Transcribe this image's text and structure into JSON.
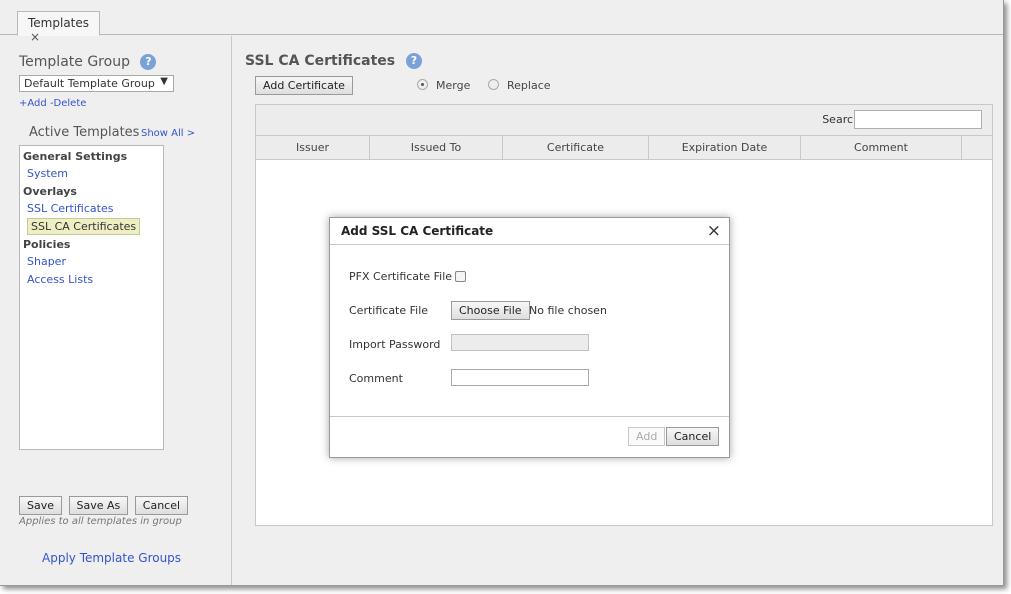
{
  "tabs": [
    {
      "label": "Templates",
      "close": "×"
    }
  ],
  "left": {
    "template_group_title": "Template Group",
    "help": "?",
    "template_group_value": "Default Template Group",
    "add_link": "+Add",
    "delete_link": "-Delete",
    "active_templates_title": "Active Templates",
    "show_all": "Show All >",
    "groups": [
      {
        "name": "General Settings",
        "items": [
          "System"
        ]
      },
      {
        "name": "Overlays",
        "items": [
          "SSL Certificates",
          "SSL CA Certificates"
        ]
      },
      {
        "name": "Policies",
        "items": [
          "Shaper",
          "Access Lists"
        ]
      }
    ],
    "selected_item": "SSL CA Certificates",
    "save": "Save",
    "save_as": "Save As",
    "cancel": "Cancel",
    "note": "Applies to all templates in group",
    "apply_link": "Apply Template Groups"
  },
  "main": {
    "title": "SSL CA Certificates",
    "add_certificate": "Add Certificate",
    "radio_merge": "Merge",
    "radio_replace": "Replace",
    "selected_radio": "Merge",
    "search_label": "Search",
    "columns": [
      "Issuer",
      "Issued To",
      "Certificate",
      "Expiration Date",
      "Comment"
    ]
  },
  "modal": {
    "title": "Add SSL CA Certificate",
    "close": "×",
    "pfx_label": "PFX Certificate File",
    "pfx_checked": false,
    "cert_file_label": "Certificate File",
    "choose_file": "Choose File",
    "no_file": "No file chosen",
    "import_password_label": "Import Password",
    "comment_label": "Comment",
    "add": "Add",
    "cancel": "Cancel"
  }
}
